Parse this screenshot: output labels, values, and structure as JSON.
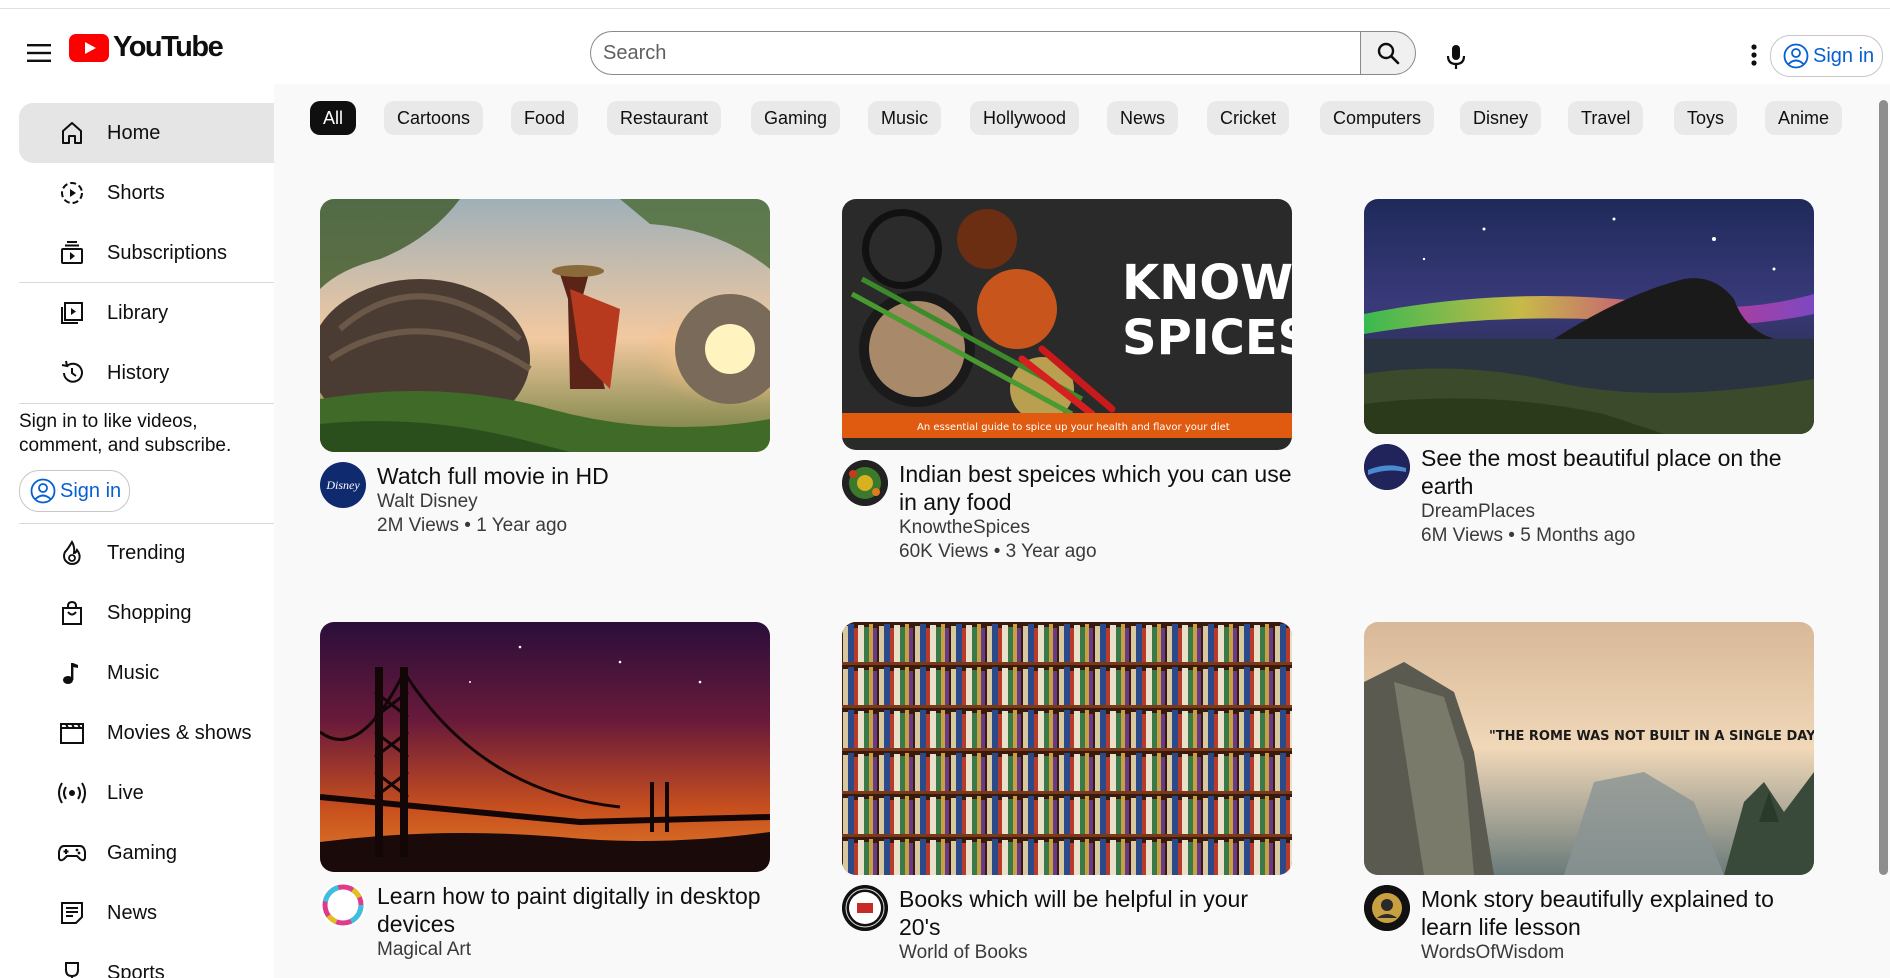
{
  "header": {
    "logo_text": "YouTube",
    "search_placeholder": "Search",
    "signin_label": "Sign in"
  },
  "sidebar": {
    "section1": [
      {
        "label": "Home",
        "icon": "home-icon",
        "active": true
      },
      {
        "label": "Shorts",
        "icon": "shorts-icon"
      },
      {
        "label": "Subscriptions",
        "icon": "subscriptions-icon"
      }
    ],
    "section2": [
      {
        "label": "Library",
        "icon": "library-icon"
      },
      {
        "label": "History",
        "icon": "history-icon"
      }
    ],
    "signin_prompt": "Sign in to like videos, comment, and subscribe.",
    "signin_label": "Sign in",
    "section3": [
      {
        "label": "Trending",
        "icon": "trending-icon"
      },
      {
        "label": "Shopping",
        "icon": "shopping-icon"
      },
      {
        "label": "Music",
        "icon": "music-icon"
      },
      {
        "label": "Movies & shows",
        "icon": "movies-icon"
      },
      {
        "label": "Live",
        "icon": "live-icon"
      },
      {
        "label": "Gaming",
        "icon": "gaming-icon"
      },
      {
        "label": "News",
        "icon": "news-icon"
      },
      {
        "label": "Sports",
        "icon": "sports-icon"
      }
    ]
  },
  "chips": [
    "All",
    "Cartoons",
    "Food",
    "Restaurant",
    "Gaming",
    "Music",
    "Hollywood",
    "News",
    "Cricket",
    "Computers",
    "Disney",
    "Travel",
    "Toys",
    "Anime"
  ],
  "videos": [
    {
      "title": "Watch full movie in HD",
      "channel": "Walt Disney",
      "stats": "2M Views • 1 Year ago"
    },
    {
      "title": "Indian best speices which you can use in any food",
      "channel": "KnowtheSpices",
      "stats": "60K Views • 3 Year ago",
      "thumb_text": "KNOW the SPICES",
      "thumb_caption": "An essential guide to spice up your health and flavor your diet"
    },
    {
      "title": "See the most beautiful place on the earth",
      "channel": "DreamPlaces",
      "stats": "6M Views • 5 Months ago"
    },
    {
      "title": "Learn how to paint digitally in desktop devices",
      "channel": "Magical Art",
      "stats": ""
    },
    {
      "title": "Books which will be helpful in your 20's",
      "channel": "World of Books",
      "stats": ""
    },
    {
      "title": "Monk story beautifully explained to learn life lesson",
      "channel": "WordsOfWisdom",
      "stats": "",
      "thumb_text": "\"THE ROME WAS NOT BUILT IN A SINGLE DAY\""
    }
  ],
  "avatar_text": {
    "disney": "Disney"
  },
  "colors": {
    "brand_red": "#ff0000",
    "link_blue": "#065fd4",
    "active_chip": "#0f0f0f"
  }
}
